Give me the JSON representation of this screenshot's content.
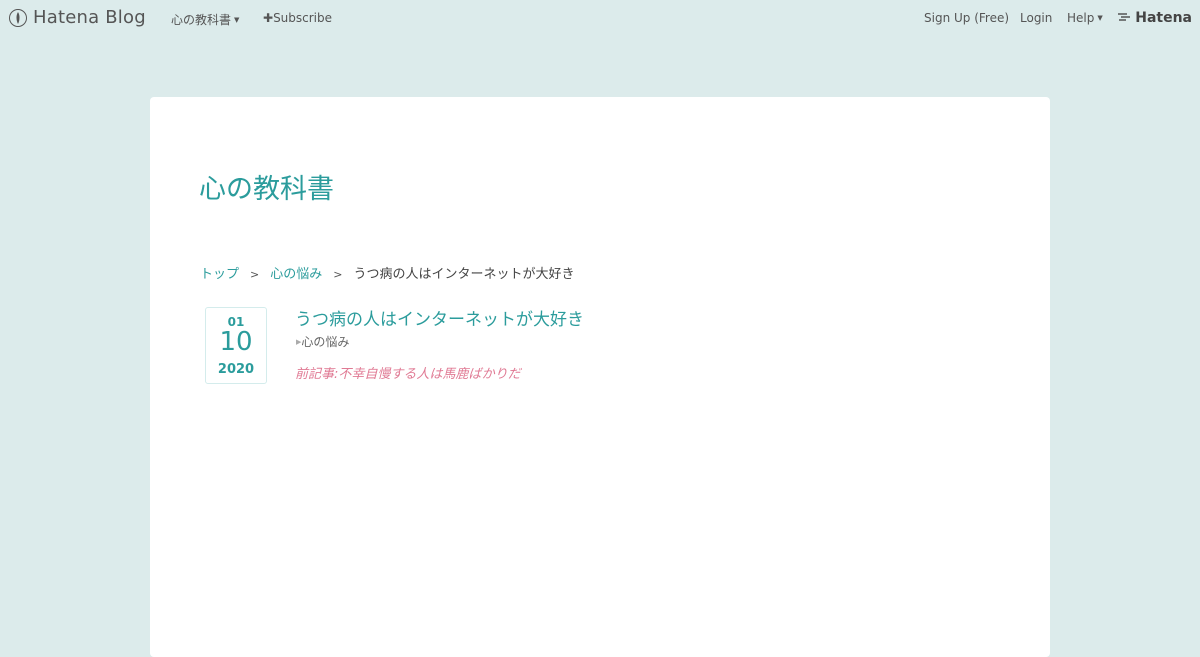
{
  "header": {
    "logo_text": "Hatena Blog",
    "blog_menu": "心の教科書",
    "subscribe": "Subscribe",
    "signup": "Sign Up (Free)",
    "login": "Login",
    "help": "Help",
    "brand": "Hatena"
  },
  "blog": {
    "title": "心の教科書"
  },
  "breadcrumb": {
    "top": "トップ",
    "category": "心の悩み",
    "current": "うつ病の人はインターネットが大好き",
    "separator": ">"
  },
  "entry": {
    "month": "01",
    "day": "10",
    "year": "2020",
    "title": "うつ病の人はインターネットが大好き",
    "category": "心の悩み",
    "prev_link": "前記事:不幸自慢する人は馬鹿ばかりだ"
  },
  "colors": {
    "background": "#dcebeb",
    "accent": "#2b9c9c",
    "prev_link": "#e07a94"
  }
}
